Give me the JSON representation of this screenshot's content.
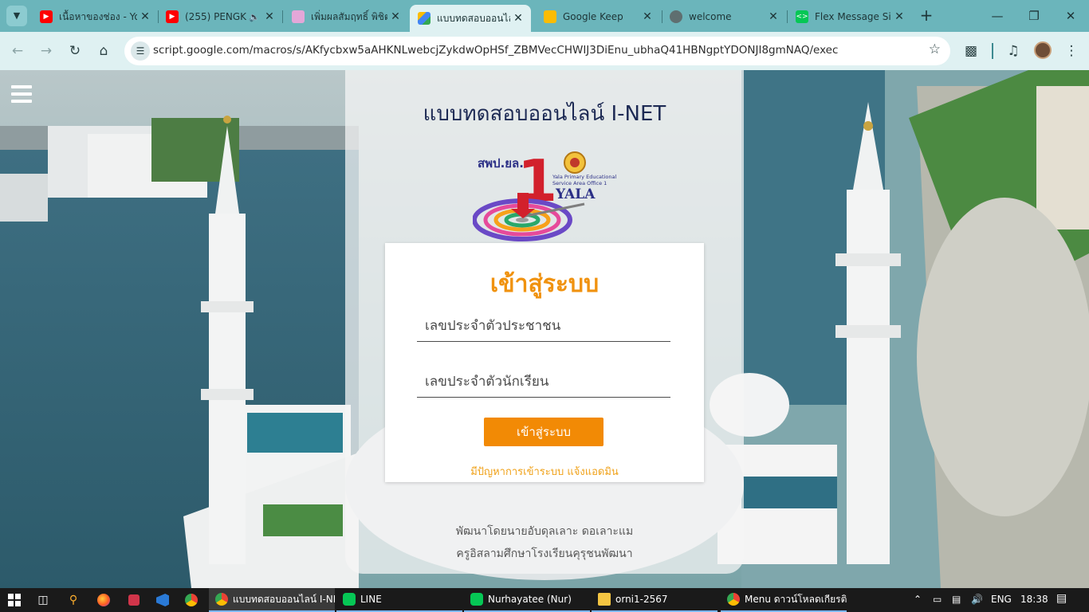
{
  "browser": {
    "tabs": [
      {
        "title": "เนื้อหาของช่อง - Yo",
        "icon": "youtube-icon",
        "active": false
      },
      {
        "title": "(255) PENGK",
        "icon": "youtube-icon",
        "active": false
      },
      {
        "title": "เพิ่มผลสัมฤทธิ์ พิชิต",
        "icon": "image-icon",
        "active": false
      },
      {
        "title": "แบบทดสอบออนไลน",
        "icon": "apps-script-icon",
        "active": true
      },
      {
        "title": "Google Keep",
        "icon": "keep-icon",
        "active": false
      },
      {
        "title": "welcome",
        "icon": "globe-icon",
        "active": false
      },
      {
        "title": "Flex Message Si",
        "icon": "code-icon",
        "active": false
      }
    ],
    "url": "script.google.com/macros/s/AKfycbxw5aAHKNLwebcjZykdwOpHSf_ZBMVecCHWIJ3DiEnu_ubhaQ41HBNgptYDONJI8gmNAQ/exec"
  },
  "page": {
    "title": "แบบทดสอบออนไลน์ I-NET",
    "logo": {
      "org_text": "สพป.ยล.",
      "number": "1",
      "line1": "Yala Primary Educational",
      "line2": "Service Area Office 1",
      "brand": "YALA"
    },
    "login": {
      "heading": "เข้าสู่ระบบ",
      "id_placeholder": "เลขประจำตัวประชาชน",
      "student_placeholder": "เลขประจำตัวนักเรียน",
      "button": "เข้าสู่ระบบ",
      "problem_link": "มีปัญหาการเข้าระบบ แจ้งแอดมิน"
    },
    "credit_line1": "พัฒนาโดยนายอับดุลเลาะ ดอเลาะแม",
    "credit_line2": "ครูอิสลามศึกษาโรงเรียนคุรุชนพัฒนา"
  },
  "taskbar": {
    "apps": [
      {
        "label": "แบบทดสอบออนไลน์ I-NE...",
        "icon": "chrome-icon",
        "state": "active"
      },
      {
        "label": "LINE",
        "icon": "line-icon",
        "state": "open"
      },
      {
        "label": "Nurhayatee (Nur)",
        "icon": "line-icon",
        "state": "open"
      },
      {
        "label": "orni1-2567",
        "icon": "folder-icon",
        "state": "open"
      },
      {
        "label": "Menu ดาวน์โหลดเกียรติ...",
        "icon": "chrome-icon",
        "state": "open"
      }
    ],
    "lang": "ENG",
    "time": "18:38"
  },
  "colors": {
    "accent_orange": "#f28a05",
    "heading_orange": "#f0920f",
    "title_navy": "#1d2a54",
    "tab_bar": "#6bb5bb",
    "toolbar": "#dff1f2"
  }
}
